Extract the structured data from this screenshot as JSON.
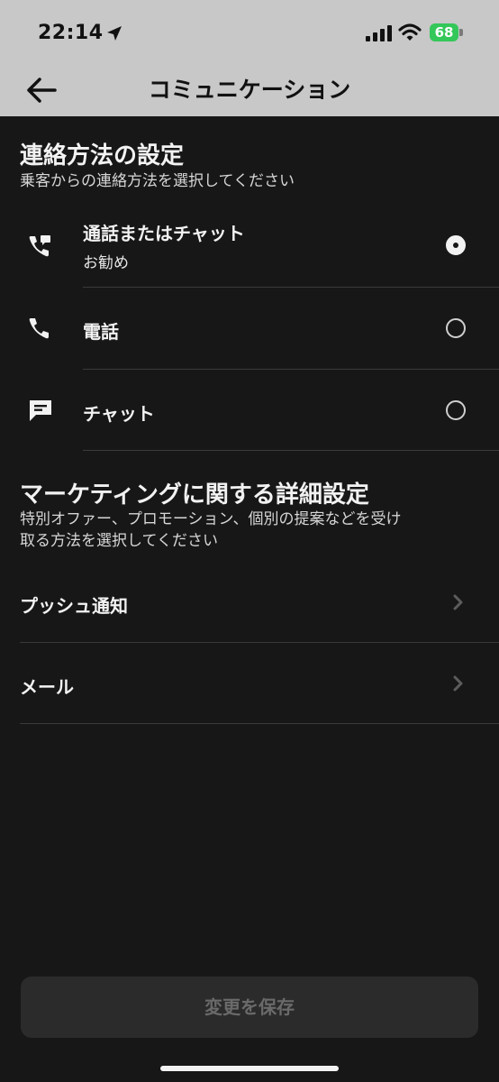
{
  "status_bar": {
    "time": "22:14",
    "battery": "68"
  },
  "header": {
    "title": "コミュニケーション"
  },
  "contact_section": {
    "title": "連絡方法の設定",
    "subtitle": "乗客からの連絡方法を選択してください",
    "options": [
      {
        "label": "通話またはチャット",
        "note": "お勧め",
        "icon": "phone-chat-icon",
        "selected": true
      },
      {
        "label": "電話",
        "icon": "phone-icon",
        "selected": false
      },
      {
        "label": "チャット",
        "icon": "chat-icon",
        "selected": false
      }
    ]
  },
  "marketing_section": {
    "title": "マーケティングに関する詳細設定",
    "subtitle_line1": "特別オファー、プロモーション、個別の提案などを受け",
    "subtitle_line2": "取る方法を選択してください",
    "links": [
      {
        "label": "プッシュ通知",
        "icon": "chevron-right-icon"
      },
      {
        "label": "メール",
        "icon": "chevron-right-icon"
      }
    ]
  },
  "footer": {
    "save_label": "変更を保存"
  },
  "colors": {
    "background": "#171717",
    "header_background": "#c8c8c8",
    "battery_green": "#34c759",
    "divider": "#3a3a3a",
    "button_disabled": "#2b2b2b"
  }
}
